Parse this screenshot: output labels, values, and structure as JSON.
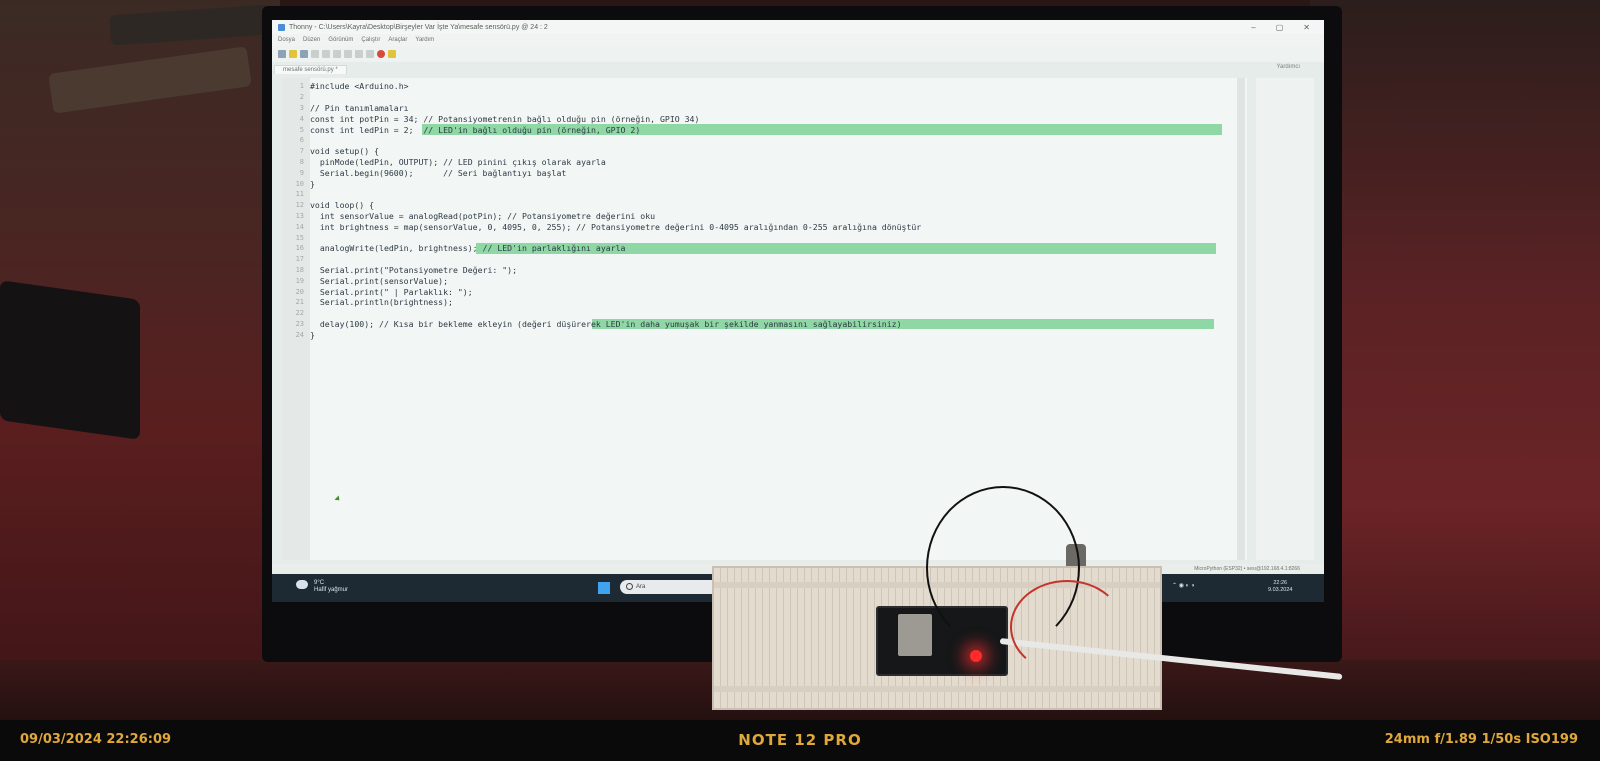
{
  "window": {
    "title": "Thonny  -  C:\\Users\\Kayra\\Desktop\\Birşeyler Var İşte Ya\\mesafe sensörü.py  @  24 : 2",
    "controls": [
      "–",
      "▢",
      "✕"
    ]
  },
  "menu": {
    "items": [
      "Dosya",
      "Düzen",
      "Görünüm",
      "Çalıştır",
      "Araçlar",
      "Yardım"
    ]
  },
  "toolbar": {
    "icons": [
      "new-file-icon",
      "open-file-icon",
      "save-icon",
      "run-icon",
      "debug-icon",
      "step-over-icon",
      "step-into-icon",
      "step-out-icon",
      "resume-icon",
      "stop-icon",
      "flag-icon"
    ]
  },
  "editor": {
    "tab_label": "mesafe sensörü.py *",
    "assistant_label": "Yardımcı",
    "highlight_color": "#8fd7a5",
    "lines": [
      {
        "n": "1",
        "text": "#include <Arduino.h>",
        "hl": false
      },
      {
        "n": "2",
        "text": "",
        "hl": false
      },
      {
        "n": "3",
        "text": "// Pin tanımlamaları",
        "hl": false
      },
      {
        "n": "4",
        "text": "const int potPin = 34; // Potansiyometrenin bağlı olduğu pin (örneğin, GPIO 34)",
        "hl": false
      },
      {
        "n": "5",
        "text": "const int ledPin = 2;  // LED'in bağlı olduğu pin (örneğin, GPIO 2)",
        "hl": true
      },
      {
        "n": "6",
        "text": "",
        "hl": false
      },
      {
        "n": "7",
        "text": "void setup() {",
        "hl": false
      },
      {
        "n": "8",
        "text": "  pinMode(ledPin, OUTPUT); // LED pinini çıkış olarak ayarla",
        "hl": false
      },
      {
        "n": "9",
        "text": "  Serial.begin(9600);      // Seri bağlantıyı başlat",
        "hl": false
      },
      {
        "n": "10",
        "text": "}",
        "hl": false
      },
      {
        "n": "11",
        "text": "",
        "hl": false
      },
      {
        "n": "12",
        "text": "void loop() {",
        "hl": false
      },
      {
        "n": "13",
        "text": "  int sensorValue = analogRead(potPin); // Potansiyometre değerini oku",
        "hl": false
      },
      {
        "n": "14",
        "text": "  int brightness = map(sensorValue, 0, 4095, 0, 255); // Potansiyometre değerini 0-4095 aralığından 0-255 aralığına dönüştür",
        "hl": false
      },
      {
        "n": "15",
        "text": "",
        "hl": false
      },
      {
        "n": "16",
        "text": "  analogWrite(ledPin, brightness); // LED'in parlaklığını ayarla",
        "hl": true
      },
      {
        "n": "17",
        "text": "",
        "hl": false
      },
      {
        "n": "18",
        "text": "  Serial.print(\"Potansiyometre Değeri: \");",
        "hl": false
      },
      {
        "n": "19",
        "text": "  Serial.print(sensorValue);",
        "hl": false
      },
      {
        "n": "20",
        "text": "  Serial.print(\" | Parlaklık: \");",
        "hl": false
      },
      {
        "n": "21",
        "text": "  Serial.println(brightness);",
        "hl": false
      },
      {
        "n": "22",
        "text": "",
        "hl": false
      },
      {
        "n": "23",
        "text": "  delay(100); // Kısa bir bekleme ekleyin (değeri düşürerek LED'in daha yumuşak bir şekilde yanmasını sağlayabilirsiniz)",
        "hl": true
      },
      {
        "n": "24",
        "text": "}",
        "hl": false
      }
    ]
  },
  "statusbar": {
    "text": "MicroPython (ESP32) • sesı@192.168.4.1:8266"
  },
  "taskbar": {
    "weather_temp": "9°C",
    "weather_desc": "Hafif yağmur",
    "search_placeholder": "Ara",
    "clock_time": "22:26",
    "clock_date": "9.03.2024"
  },
  "camera": {
    "datetime": "09/03/2024  22:26:09",
    "model": "NOTE 12 PRO",
    "exposure": "24mm  f/1.89  1/50s  ISO199"
  }
}
